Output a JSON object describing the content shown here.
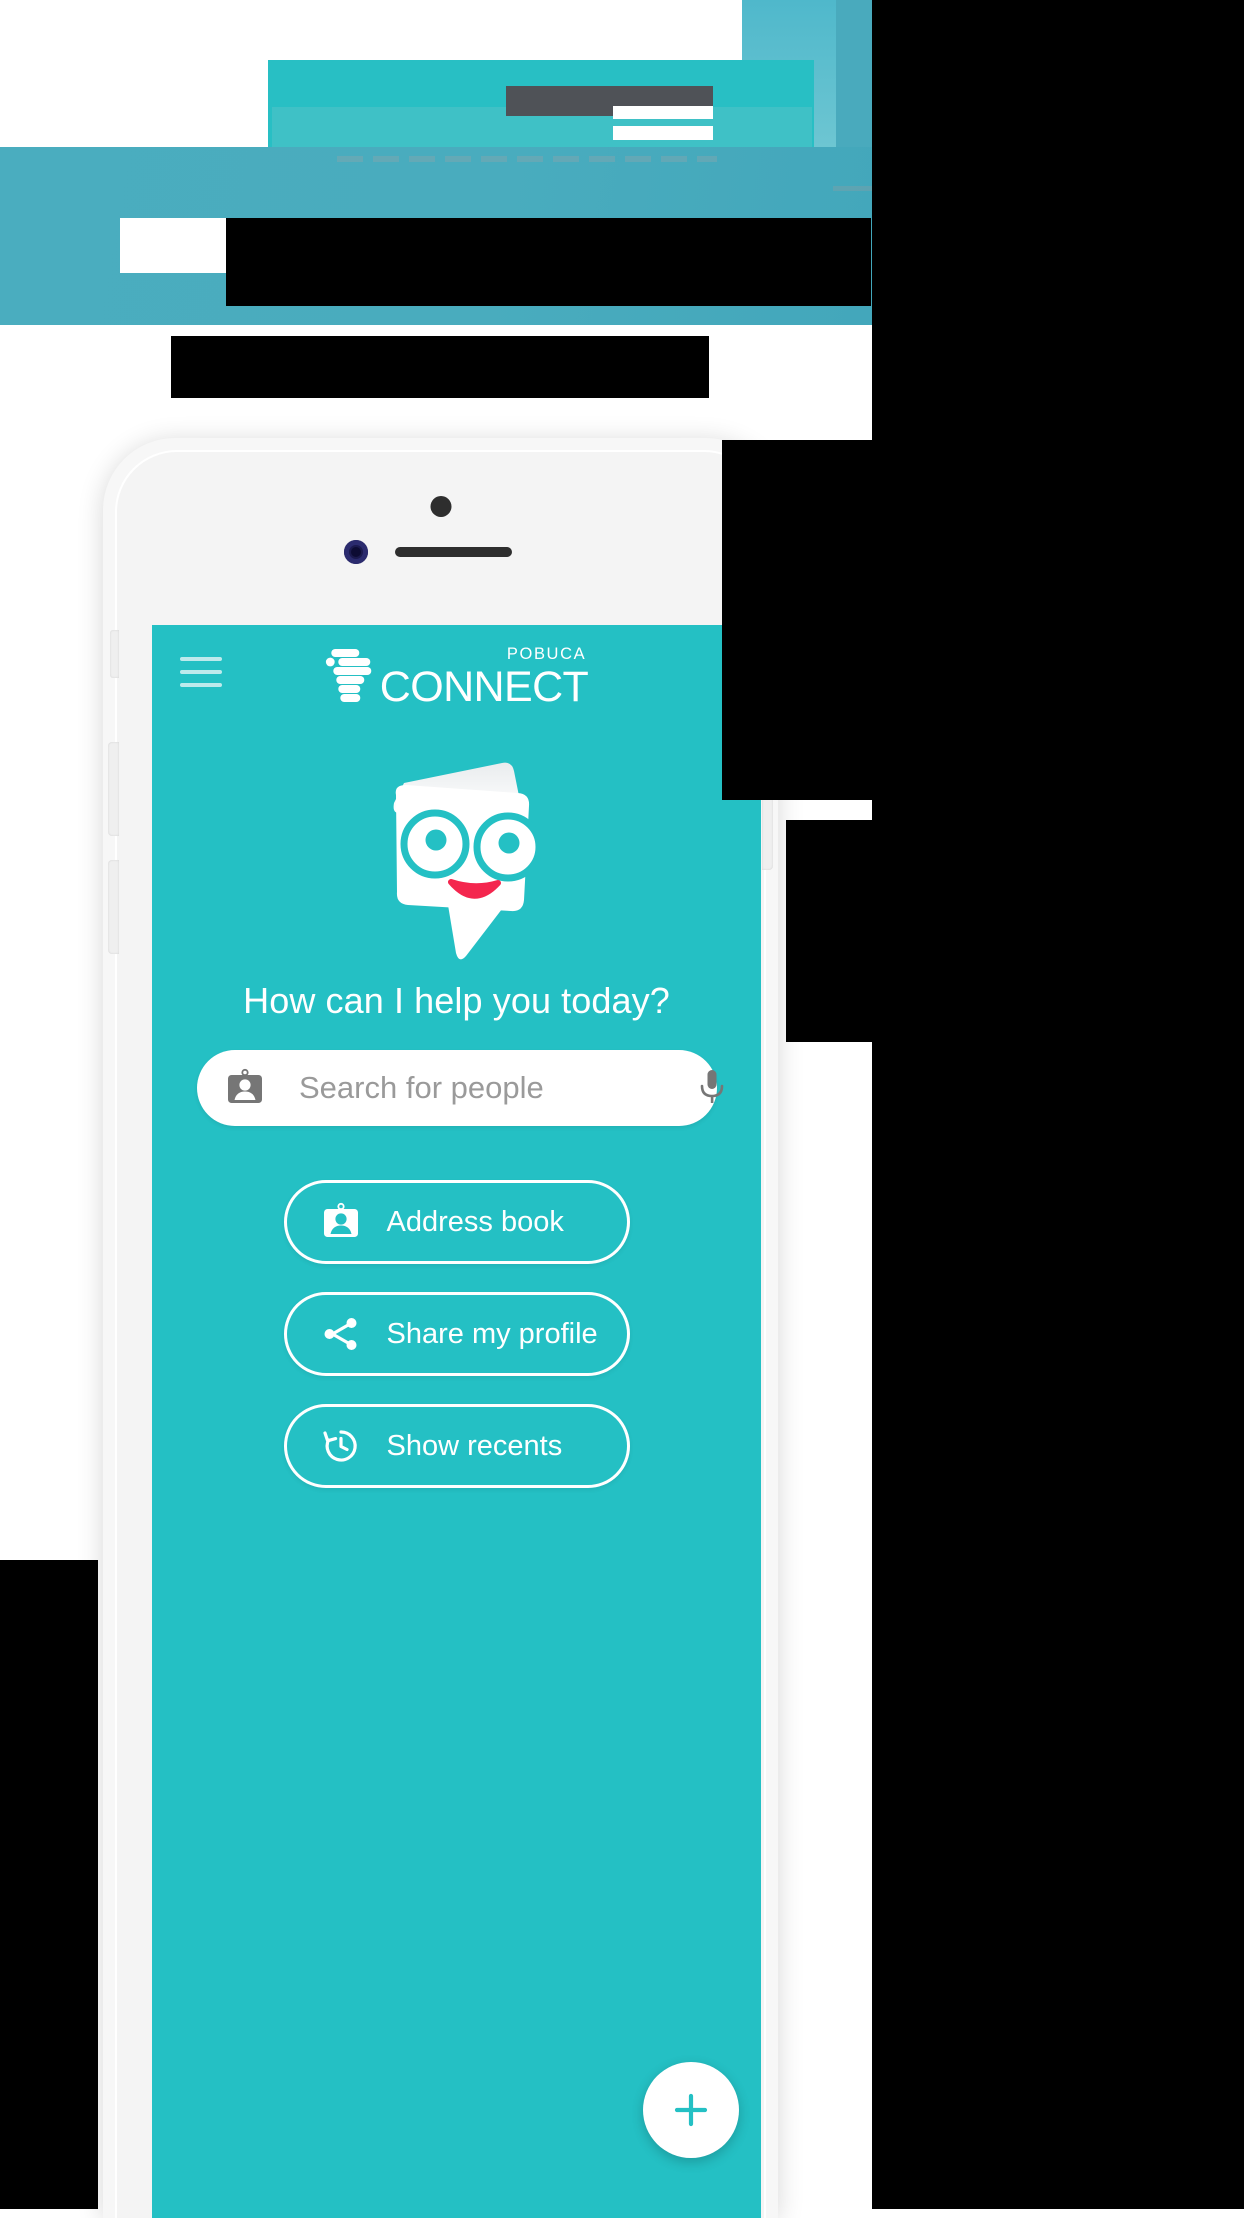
{
  "hero": {
    "redacted": true,
    "note": "headline area obscured by solid black and teal redaction blocks",
    "colors": {
      "teal_band": "#28bfc4",
      "blue_band": "#4aadbf",
      "grey_block": "#4f5257",
      "redaction": "#000000"
    }
  },
  "phone": {
    "device": "white smartphone mockup",
    "frame_color": "#f7f7f7",
    "hardware": {
      "front_camera": "camera-dot",
      "proximity_sensor": "sensor-dot",
      "earpiece": "speaker-grille",
      "volume_buttons": 2,
      "mute_switch": 1,
      "power_button": 1
    }
  },
  "app": {
    "screen_bg": "#24c0c4",
    "header": {
      "menu_icon": "hamburger-icon",
      "brand_small": "POBUCA",
      "brand_main": "CONNECT",
      "logo_icon": "pobuca-stack-logo"
    },
    "mascot": {
      "name": "pobuca-bot-face",
      "face_color": "#ffffff",
      "eye_color": "#24c0c4",
      "mouth_color": "#f4264e"
    },
    "tagline": "How can I help you today?",
    "search": {
      "icon": "contact-card-icon",
      "placeholder": "Search for people",
      "value": "",
      "mic_icon": "microphone-icon"
    },
    "actions": [
      {
        "icon": "contact-card-icon",
        "label": "Address book"
      },
      {
        "icon": "share-icon",
        "label": "Share my profile"
      },
      {
        "icon": "history-icon",
        "label": "Show recents"
      }
    ],
    "fab": {
      "icon": "plus-icon",
      "label": "+",
      "color": "#24c0c4"
    }
  }
}
